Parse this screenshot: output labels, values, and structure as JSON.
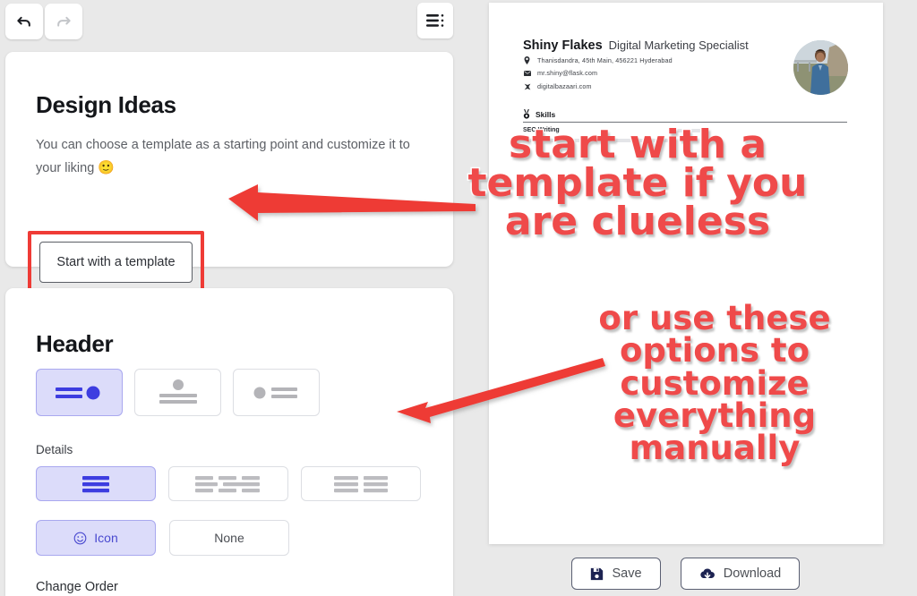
{
  "toolbar": {
    "undo_label": "Undo",
    "redo_label": "Redo",
    "menu_label": "Menu"
  },
  "design_ideas": {
    "title": "Design Ideas",
    "description": "You can choose a template as a starting point and customize it to your liking ",
    "emoji": "🙂",
    "start_button_label": "Start with a template",
    "highlight_color": "#ef3b36"
  },
  "header_panel": {
    "title": "Header",
    "accent_color": "#3d3de0",
    "selected_background": "#dcdcfa",
    "style_options": [
      {
        "name": "lines-left-dot-right",
        "selected": true
      },
      {
        "name": "dot-top-centered-lines",
        "selected": false
      },
      {
        "name": "dot-left-lines-right",
        "selected": false
      }
    ],
    "details_label": "Details",
    "details_options": [
      {
        "name": "single-column",
        "selected": true
      },
      {
        "name": "three-column",
        "selected": false
      },
      {
        "name": "two-column",
        "selected": false
      }
    ],
    "icon_toggle": [
      {
        "label": "Icon",
        "icon": "smiley-icon",
        "selected": true
      },
      {
        "label": "None",
        "icon": "",
        "selected": false
      }
    ],
    "change_order_label": "Change Order"
  },
  "resume_preview": {
    "name": "Shiny Flakes",
    "role": "Digital Marketing Specialist",
    "contacts": [
      {
        "icon": "location-pin-icon",
        "text": "Thanisdandra, 45th Main, 456221 Hyderabad"
      },
      {
        "icon": "envelope-icon",
        "text": "mr.shiny@flask.com"
      },
      {
        "icon": "link-icon",
        "text": "digitalbazaari.com"
      }
    ],
    "photo_alt": "profile-photo",
    "skills_section_title": "Skills",
    "skills": [
      "SEO Writing"
    ]
  },
  "preview_actions": {
    "save_label": "Save",
    "save_icon": "floppy-disk-icon",
    "download_label": "Download",
    "download_icon": "cloud-download-icon"
  },
  "annotations": {
    "color": "#ef4a4a",
    "note_1": "start with a\ntemplate if you\nare clueless",
    "note_2": "or use these\noptions to\ncustomize\neverything\nmanually"
  }
}
